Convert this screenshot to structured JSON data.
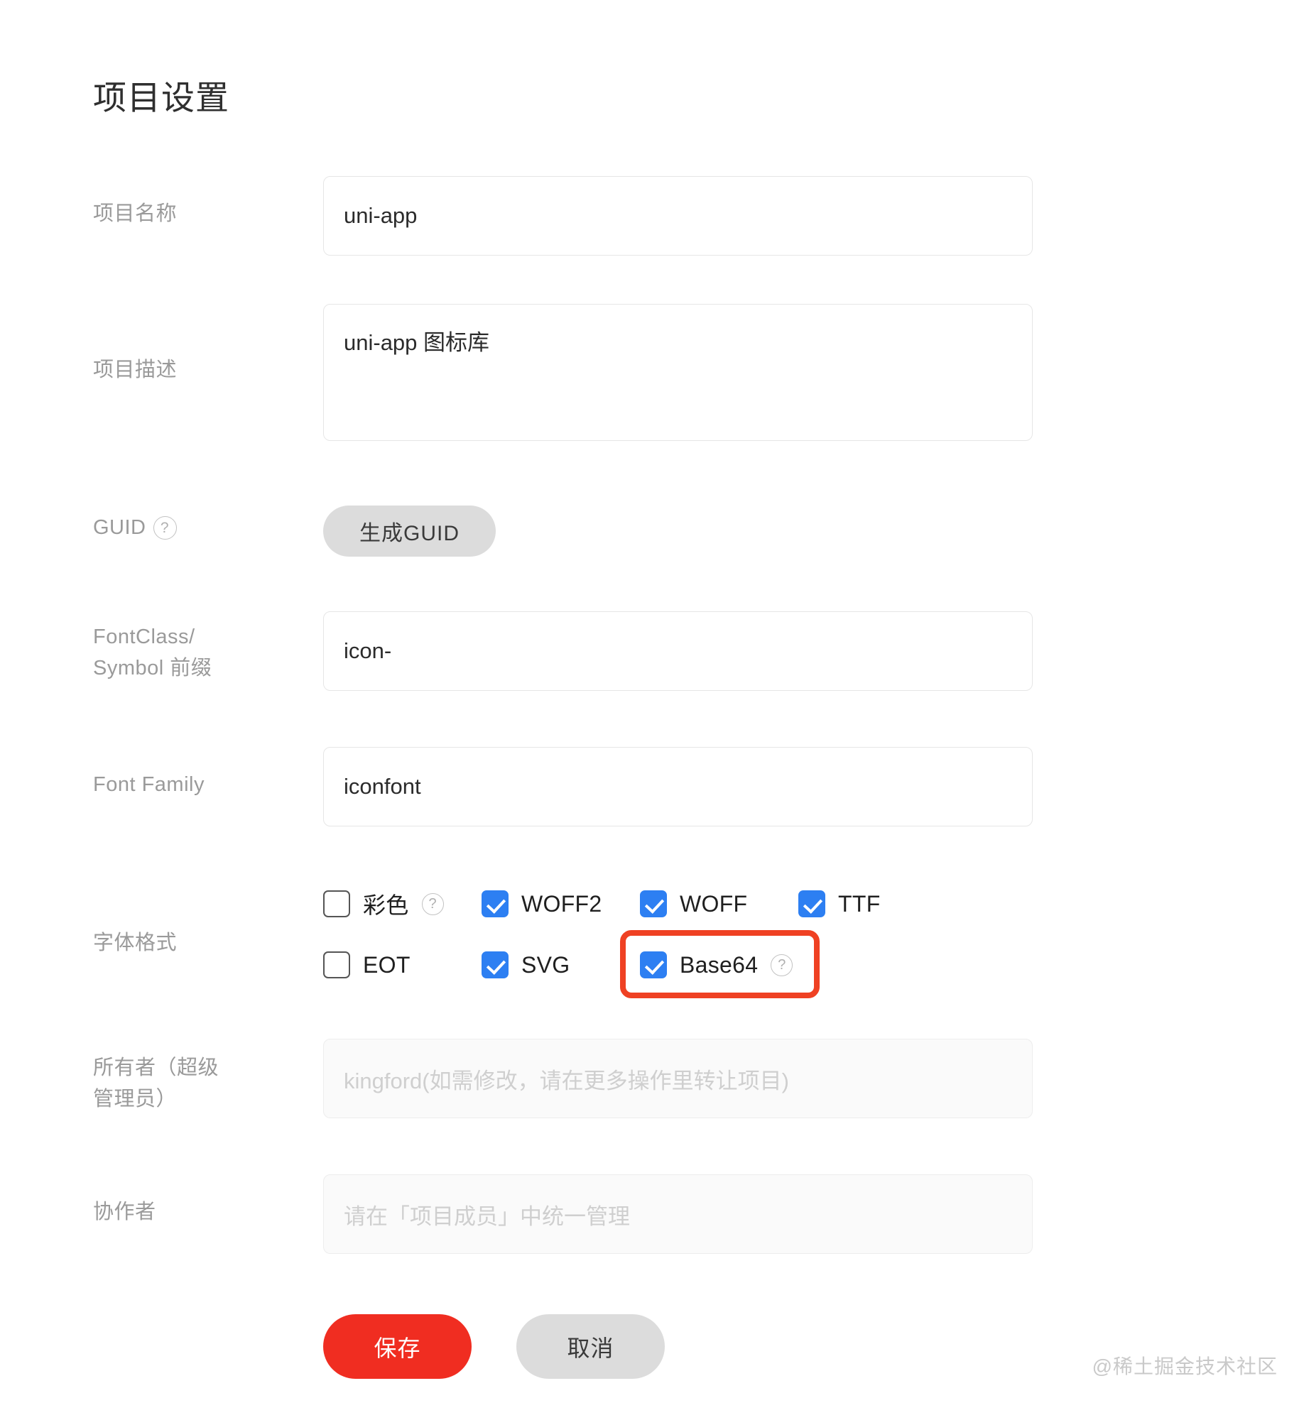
{
  "page": {
    "title": "项目设置",
    "watermark": "@稀土掘金技术社区"
  },
  "form": {
    "project_name": {
      "label": "项目名称",
      "value": "uni-app"
    },
    "project_description": {
      "label": "项目描述",
      "value": "uni-app 图标库"
    },
    "guid": {
      "label": "GUID",
      "help_icon": "question-circle-icon",
      "button_label": "生成GUID"
    },
    "fontclass_prefix": {
      "label_line1": "FontClass/",
      "label_line2": "Symbol 前缀",
      "value": "icon-"
    },
    "font_family": {
      "label": "Font Family",
      "value": "iconfont"
    },
    "font_formats": {
      "label": "字体格式",
      "options": [
        {
          "label": "彩色",
          "checked": false,
          "help": true,
          "row": 0,
          "col": 0
        },
        {
          "label": "WOFF2",
          "checked": true,
          "help": false,
          "row": 0,
          "col": 1
        },
        {
          "label": "WOFF",
          "checked": true,
          "help": false,
          "row": 0,
          "col": 2
        },
        {
          "label": "TTF",
          "checked": true,
          "help": false,
          "row": 0,
          "col": 3
        },
        {
          "label": "EOT",
          "checked": false,
          "help": false,
          "row": 1,
          "col": 0
        },
        {
          "label": "SVG",
          "checked": true,
          "help": false,
          "row": 1,
          "col": 1
        },
        {
          "label": "Base64",
          "checked": true,
          "help": true,
          "row": 1,
          "col": 2,
          "highlighted": true
        }
      ],
      "highlight_color": "#ef4123"
    },
    "owner": {
      "label_line1": "所有者（超级",
      "label_line2": "管理员）",
      "placeholder": "kingford(如需修改，请在更多操作里转让项目)",
      "disabled": true
    },
    "collaborators": {
      "label": "协作者",
      "placeholder": "请在「项目成员」中统一管理",
      "disabled": true
    }
  },
  "actions": {
    "save_label": "保存",
    "cancel_label": "取消",
    "save_color": "#f02d21",
    "cancel_color": "#dcdcdc"
  }
}
